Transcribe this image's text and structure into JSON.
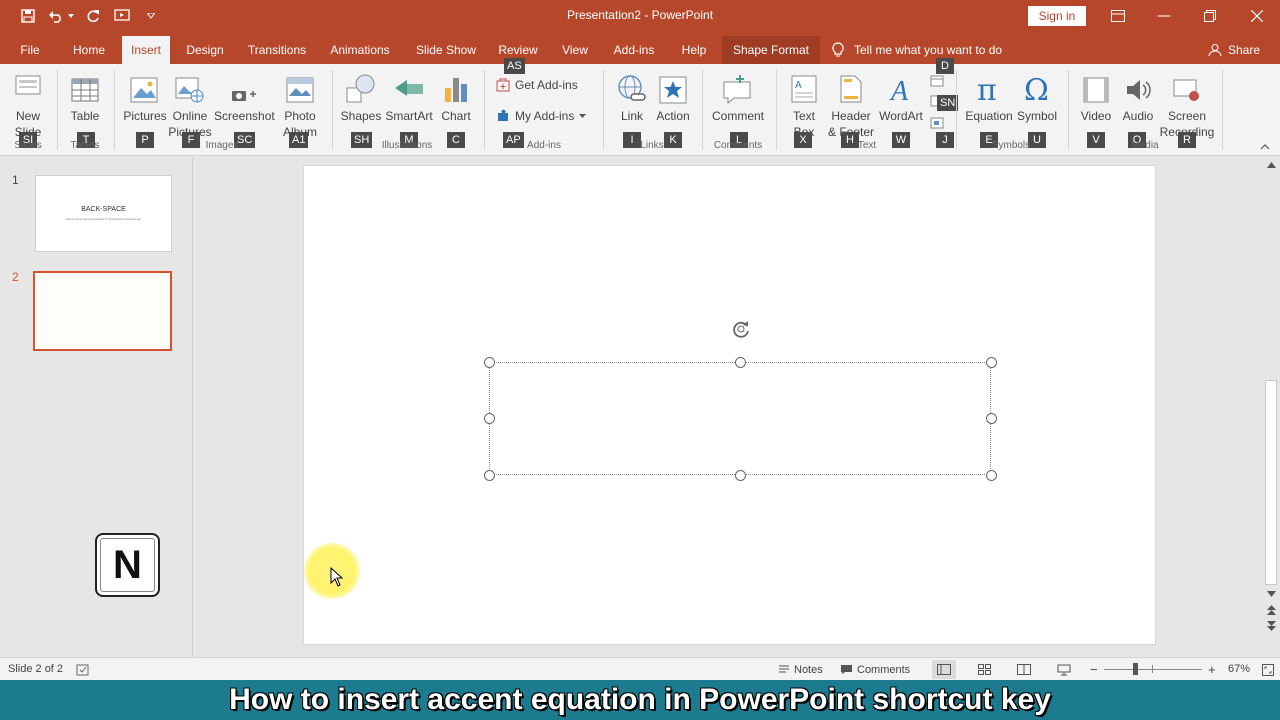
{
  "window": {
    "title": "Presentation2 - PowerPoint",
    "sign_in": "Sign in"
  },
  "tabs": [
    {
      "label": "File"
    },
    {
      "label": "Home"
    },
    {
      "label": "Insert",
      "active": true
    },
    {
      "label": "Design"
    },
    {
      "label": "Transitions"
    },
    {
      "label": "Animations"
    },
    {
      "label": "Slide Show"
    },
    {
      "label": "Review"
    },
    {
      "label": "View"
    },
    {
      "label": "Add-ins"
    },
    {
      "label": "Help"
    },
    {
      "label": "Shape Format"
    }
  ],
  "tell_me": "Tell me what you want to do",
  "share": "Share",
  "ribbon": {
    "new_slide": {
      "line1": "New",
      "line2": "Slide",
      "key": "SI"
    },
    "table": {
      "label": "Table",
      "key": "T"
    },
    "pictures": {
      "label": "Pictures",
      "key": "P"
    },
    "online_pictures": {
      "line1": "Online",
      "line2": "Pictures",
      "key": "F"
    },
    "screenshot": {
      "label": "Screenshot",
      "key": "SC"
    },
    "photo_album": {
      "line1": "Photo",
      "line2": "Album",
      "key": "A1"
    },
    "shapes": {
      "label": "Shapes",
      "key": "SH"
    },
    "smartart": {
      "label": "SmartArt",
      "key": "M"
    },
    "chart": {
      "label": "Chart",
      "key": "C"
    },
    "get_addins": {
      "label": "Get Add-ins",
      "key": "AS"
    },
    "my_addins": {
      "label": "My Add-ins",
      "key": "AP"
    },
    "link": {
      "label": "Link",
      "key": "I"
    },
    "action": {
      "label": "Action",
      "key": "K"
    },
    "comment": {
      "label": "Comment",
      "key": "L"
    },
    "text_box": {
      "line1": "Text",
      "line2": "Box",
      "key": "X"
    },
    "header_footer": {
      "line1": "Header",
      "line2": "& Footer",
      "key": "H"
    },
    "wordart": {
      "label": "WordArt",
      "key": "W"
    },
    "date_key": "D",
    "slide_number_key": "SN",
    "object_key": "J",
    "equation": {
      "label": "Equation",
      "key": "E"
    },
    "symbol": {
      "label": "Symbol",
      "key": "U"
    },
    "video": {
      "label": "Video",
      "key": "V"
    },
    "audio": {
      "label": "Audio",
      "key": "O"
    },
    "screen_recording": {
      "line1": "Screen",
      "line2": "Recording",
      "key": "R"
    },
    "groups": {
      "slides": "Slides",
      "tables": "Tables",
      "images": "Images",
      "illustrations": "Illustrations",
      "addins": "Add-ins",
      "links": "Links",
      "comments": "Comments",
      "text": "Text",
      "symbols": "Symbols",
      "media": "Media"
    }
  },
  "slides": [
    {
      "number": "1",
      "title": "BACK-SPACE",
      "subtitle": "How to insert accent equation in PowerPoint shortcut key"
    },
    {
      "number": "2"
    }
  ],
  "key_overlay": "N",
  "status": {
    "slide_info": "Slide 2 of 2",
    "notes": "Notes",
    "comments": "Comments",
    "zoom_minus": "−",
    "zoom_plus": "+",
    "zoom": "67%",
    "zoom_level": 0.67
  },
  "caption": "How to insert accent equation in PowerPoint shortcut key",
  "colors": {
    "accent": "#b7472a",
    "selection": "#d35230",
    "caption_bg": "#1d7b8f"
  }
}
